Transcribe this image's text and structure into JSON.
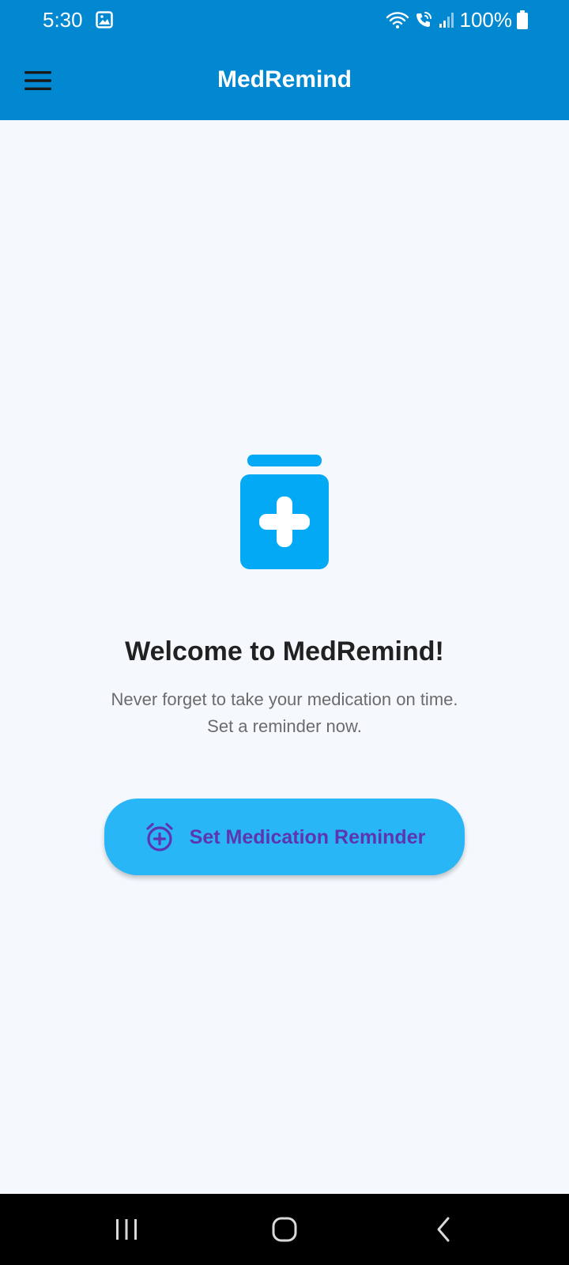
{
  "status_bar": {
    "time": "5:30",
    "battery": "100%",
    "icons": [
      "gallery-icon",
      "wifi-icon",
      "wifi-calling-icon",
      "signal-icon",
      "battery-icon"
    ]
  },
  "app_bar": {
    "title": "MedRemind",
    "menu_icon": "menu-icon"
  },
  "hero": {
    "icon": "medicine-bottle-icon",
    "title": "Welcome to MedRemind!",
    "subtitle_line1": "Never forget to take your medication on time.",
    "subtitle_line2": "Set a reminder now."
  },
  "action_button": {
    "label": "Set Medication Reminder",
    "icon": "alarm-add-icon"
  },
  "nav_bar": {
    "buttons": [
      "recent-apps-icon",
      "home-icon",
      "back-icon"
    ]
  },
  "colors": {
    "primary": "#0288d1",
    "background": "#f5f9fe",
    "hero_icon": "#03a9f4",
    "button": "#29b6f6",
    "button_text": "#5e35b1",
    "title_text": "#212121",
    "subtitle_text": "#6b6b6b"
  }
}
